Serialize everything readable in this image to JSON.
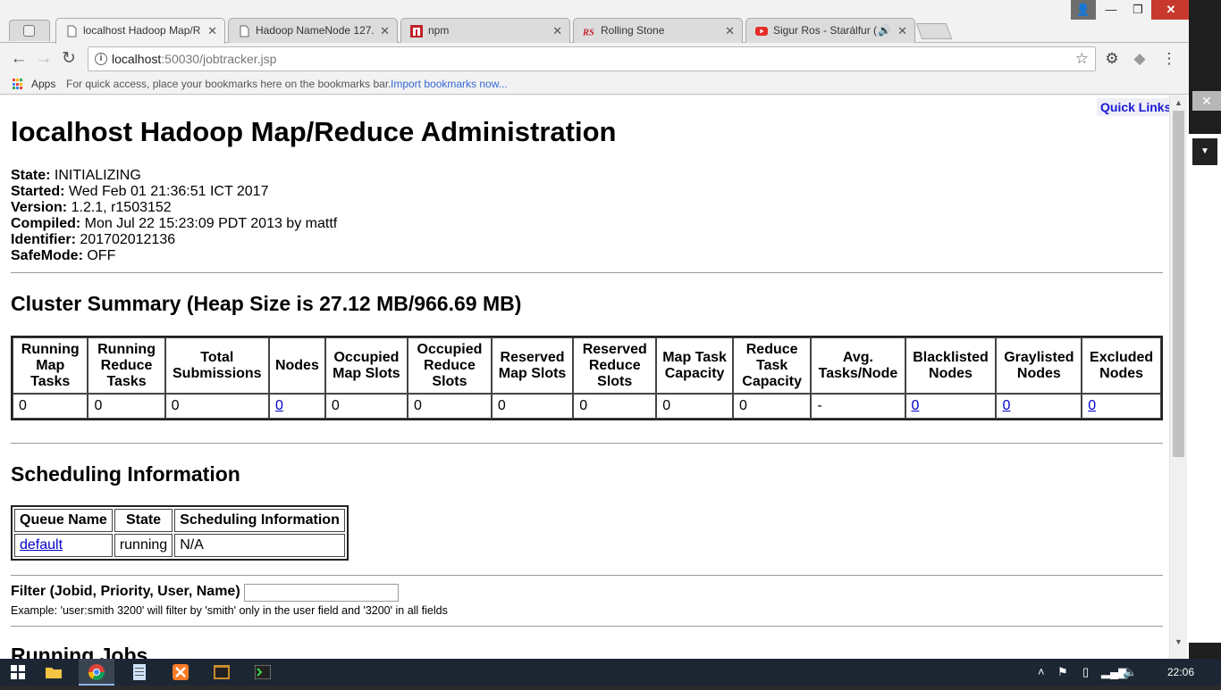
{
  "browser": {
    "tabs": [
      {
        "title": "localhost Hadoop Map/R",
        "icon": "document-icon",
        "active": true
      },
      {
        "title": "Hadoop NameNode 127.",
        "icon": "document-icon",
        "active": false
      },
      {
        "title": "npm",
        "icon": "npm-logo-icon",
        "active": false
      },
      {
        "title": "Rolling Stone",
        "icon": "rolling-stone-logo-icon",
        "active": false
      },
      {
        "title": "Sigur Ros - Starálfur (",
        "icon": "youtube-logo-icon",
        "active": false
      }
    ],
    "address": {
      "host": "localhost",
      "path": ":50030/jobtracker.jsp"
    },
    "bookmarks": {
      "apps_label": "Apps",
      "hint": "For quick access, place your bookmarks here on the bookmarks bar.",
      "import_link": "Import bookmarks now..."
    }
  },
  "page": {
    "quick_links": "Quick Links",
    "title": "localhost Hadoop Map/Reduce Administration",
    "info": [
      {
        "label": "State:",
        "value": "INITIALIZING"
      },
      {
        "label": "Started:",
        "value": "Wed Feb 01 21:36:51 ICT 2017"
      },
      {
        "label": "Version:",
        "value": "1.2.1, r1503152"
      },
      {
        "label": "Compiled:",
        "value": "Mon Jul 22 15:23:09 PDT 2013 by mattf"
      },
      {
        "label": "Identifier:",
        "value": "201702012136"
      },
      {
        "label": "SafeMode:",
        "value": "OFF"
      }
    ],
    "cluster_summary": {
      "heading": "Cluster Summary (Heap Size is 27.12 MB/966.69 MB)",
      "columns": [
        "Running Map Tasks",
        "Running Reduce Tasks",
        "Total Submissions",
        "Nodes",
        "Occupied Map Slots",
        "Occupied Reduce Slots",
        "Reserved Map Slots",
        "Reserved Reduce Slots",
        "Map Task Capacity",
        "Reduce Task Capacity",
        "Avg. Tasks/Node",
        "Blacklisted Nodes",
        "Graylisted Nodes",
        "Excluded Nodes"
      ],
      "values": [
        "0",
        "0",
        "0",
        "0",
        "0",
        "0",
        "0",
        "0",
        "0",
        "0",
        "-",
        "0",
        "0",
        "0"
      ]
    },
    "scheduling": {
      "heading": "Scheduling Information",
      "columns": [
        "Queue Name",
        "State",
        "Scheduling Information"
      ],
      "row": {
        "queue": "default",
        "state": "running",
        "info": "N/A"
      }
    },
    "filter": {
      "label": "Filter (Jobid, Priority, User, Name)",
      "value": "",
      "example": "Example: 'user:smith 3200' will filter by 'smith' only in the user field and '3200' in all fields"
    },
    "next_heading": "Running Jobs"
  },
  "taskbar": {
    "clock": "22:06"
  }
}
